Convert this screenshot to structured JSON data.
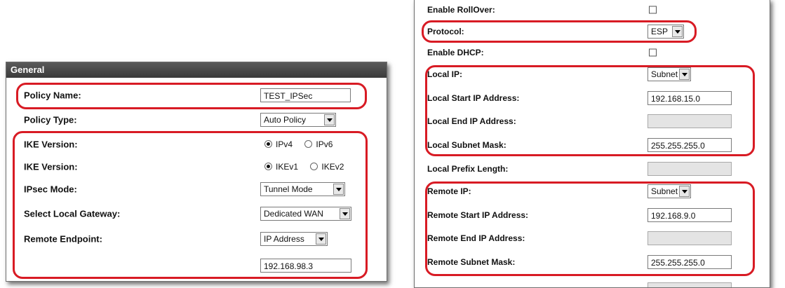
{
  "general_panel": {
    "header": "General",
    "policy_name": {
      "label": "Policy Name:",
      "value": "TEST_IPSec"
    },
    "policy_type": {
      "label": "Policy Type:",
      "value": "Auto Policy"
    },
    "ike_ip_version": {
      "label": "IKE Version:",
      "options": [
        "IPv4",
        "IPv6"
      ],
      "selected": "IPv4"
    },
    "ike_version": {
      "label": "IKE Version:",
      "options": [
        "IKEv1",
        "IKEv2"
      ],
      "selected": "IKEv1"
    },
    "ipsec_mode": {
      "label": "IPsec Mode:",
      "value": "Tunnel Mode"
    },
    "local_gateway": {
      "label": "Select Local Gateway:",
      "value": "Dedicated WAN"
    },
    "remote_endpoint": {
      "label": "Remote Endpoint:",
      "type": "IP Address",
      "value": "192.168.98.3"
    }
  },
  "policy_panel": {
    "enable_rollover": {
      "label": "Enable RollOver:",
      "checked": false
    },
    "protocol": {
      "label": "Protocol:",
      "value": "ESP"
    },
    "enable_dhcp": {
      "label": "Enable DHCP:",
      "checked": false
    },
    "local_ip": {
      "label": "Local IP:",
      "value": "Subnet"
    },
    "local_start_ip": {
      "label": "Local Start IP Address:",
      "value": "192.168.15.0"
    },
    "local_end_ip": {
      "label": "Local End IP Address:",
      "value": ""
    },
    "local_subnet_mask": {
      "label": "Local Subnet Mask:",
      "value": "255.255.255.0"
    },
    "local_prefix_length": {
      "label": "Local Prefix Length:",
      "value": ""
    },
    "remote_ip": {
      "label": "Remote IP:",
      "value": "Subnet"
    },
    "remote_start_ip": {
      "label": "Remote Start IP Address:",
      "value": "192.168.9.0"
    },
    "remote_end_ip": {
      "label": "Remote End IP Address:",
      "value": ""
    },
    "remote_subnet_mask": {
      "label": "Remote Subnet Mask:",
      "value": "255.255.255.0"
    }
  },
  "colors": {
    "highlight": "#d81b24",
    "header_bg": "#444444",
    "disabled_field": "#e4e4e4"
  }
}
